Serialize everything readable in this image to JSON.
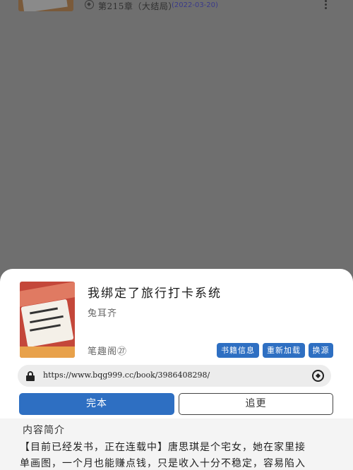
{
  "background_list": {
    "chapter_title": "第215章（大结局）",
    "chapter_date": "(2022-03-20)"
  },
  "book": {
    "title": "我绑定了旅行打卡系统",
    "author": "兔耳齐",
    "source_name": "笔趣阁㉗",
    "url": "https://www.bqg999.cc/book/3986408298/"
  },
  "actions": {
    "book_info": "书籍信息",
    "reload": "重新加载",
    "change_source": "换源",
    "finished": "完本",
    "follow": "追更"
  },
  "intro": {
    "heading": "内容简介",
    "line1": "【目前已经发书，正在连载中】唐思琪是个宅女，她在家里接",
    "line2": "单画图，一个月也能赚点钱，只是收入十分不稳定，容易陷入"
  },
  "colors": {
    "accent": "#2e6fc2",
    "overlay": "#6f6f6f"
  }
}
